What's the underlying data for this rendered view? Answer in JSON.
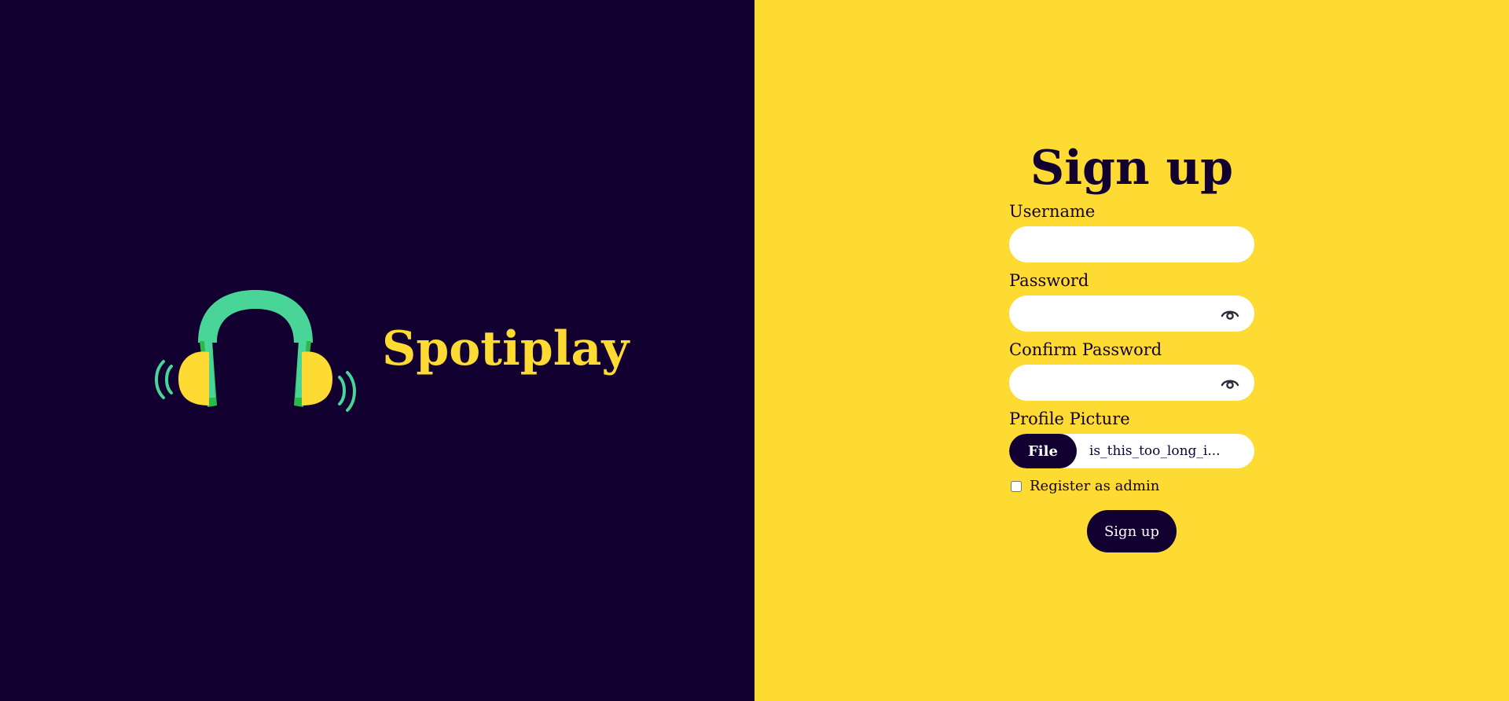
{
  "brand": {
    "name": "Spotiplay",
    "logo_icon": "headphones-icon"
  },
  "colors": {
    "dark": "#120030",
    "yellow": "#FEDB32",
    "green": "#48D597",
    "dark_green": "#2DB84A"
  },
  "form": {
    "title": "Sign up",
    "username": {
      "label": "Username",
      "value": ""
    },
    "password": {
      "label": "Password",
      "value": "",
      "toggle_icon": "eye-icon"
    },
    "confirm_password": {
      "label": "Confirm Password",
      "value": "",
      "toggle_icon": "eye-icon"
    },
    "profile_picture": {
      "label": "Profile Picture",
      "button_label": "File",
      "file_name": "is_this_too_long_i..."
    },
    "admin_checkbox": {
      "label": "Register as admin",
      "checked": false
    },
    "submit_label": "Sign up"
  }
}
